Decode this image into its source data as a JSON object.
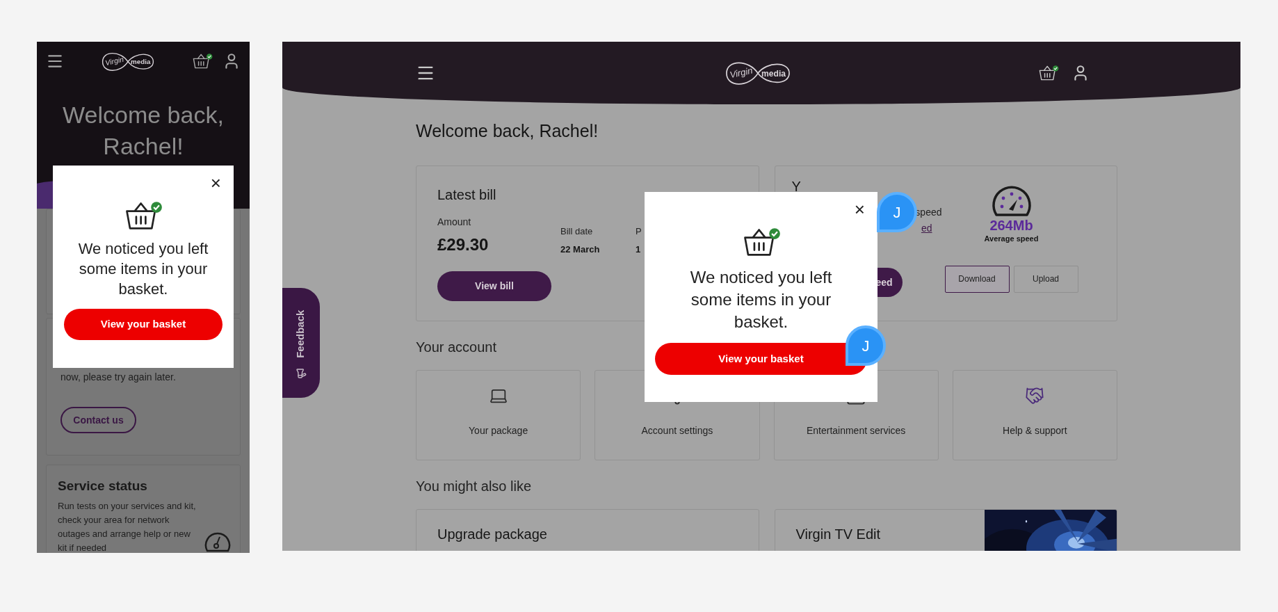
{
  "mobile": {
    "logo": {
      "script": "Virgin",
      "word": "media"
    },
    "welcome": "Welcome back, Rachel!",
    "status_card": {
      "text": "now, please try again later.",
      "button": "Contact us"
    },
    "service_card": {
      "title": "Service status",
      "text": "Run tests on your services and kit, check your area for network outages and arrange help or new kit if needed"
    },
    "modal": {
      "close": "×",
      "message": "We noticed you left some items in your basket.",
      "button": "View your basket"
    }
  },
  "desktop": {
    "logo": {
      "script": "Virgin",
      "word": "media"
    },
    "welcome": "Welcome back, Rachel!",
    "feedback": "Feedback",
    "bill_card": {
      "title": "Latest bill",
      "amount_label": "Amount",
      "amount": "£29.30",
      "date_label": "Bill date",
      "date": "22 March",
      "column_3_label": "P",
      "column_3_value": "1",
      "button": "View bill"
    },
    "speed_card": {
      "title": "Y",
      "text": "speed",
      "link": "ed",
      "button": "eed",
      "speed": "264Mb",
      "speed_label": "Average speed",
      "tabs": [
        {
          "label": "Download",
          "selected": true
        },
        {
          "label": "Upload",
          "selected": false
        }
      ]
    },
    "account_title": "Your account",
    "tiles": [
      {
        "kind": "laptop",
        "label": "Your package"
      },
      {
        "kind": "settings",
        "label": "Account settings"
      },
      {
        "kind": "tv",
        "label": "Entertainment services"
      },
      {
        "kind": "help",
        "label": "Help & support"
      }
    ],
    "suggest_title": "You might also like",
    "suggestions": [
      {
        "title": "Upgrade package"
      },
      {
        "title": "Virgin TV Edit",
        "kind": "picture"
      }
    ],
    "avatars": [
      "J",
      "J"
    ],
    "modal": {
      "close": "×",
      "message": "We noticed you left some items in your basket.",
      "button": "View your basket"
    }
  }
}
